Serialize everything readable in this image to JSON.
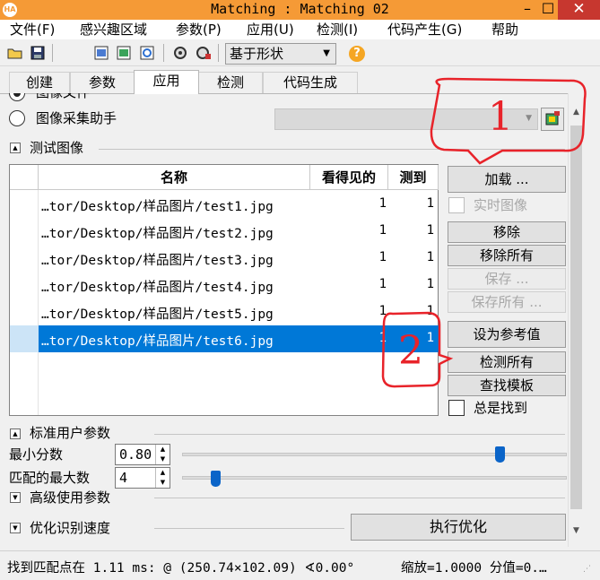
{
  "window": {
    "title": "Matching : Matching 02",
    "app_icon": "HA",
    "minimize": "–",
    "maximize": "☐",
    "close": "✕"
  },
  "menu": [
    "文件(F)",
    "感兴趣区域",
    "参数(P)",
    "应用(U)",
    "检测(I)",
    "代码产生(G)",
    "帮助"
  ],
  "toolbar": {
    "icons": [
      "open-folder-icon",
      "save-disk-icon",
      "image-icon",
      "image-add-icon",
      "image-refresh-icon",
      "gear-run-icon",
      "gear-settings-icon",
      "help-icon"
    ],
    "shape_select": "基于形状",
    "help": "?"
  },
  "tabs": [
    "创建",
    "参数",
    "应用",
    "检测",
    "代码生成"
  ],
  "active_tab": "应用",
  "source": {
    "image_file_label": "图像文件",
    "acq_assistant_label": "图像采集助手",
    "acq_combo_value": ""
  },
  "test_images": {
    "header": "测试图像",
    "columns": [
      "名称",
      "看得见的",
      "测到"
    ],
    "rows": [
      {
        "name": "…tor/Desktop/样品图片/test1.jpg",
        "visible": "1",
        "found": "1"
      },
      {
        "name": "…tor/Desktop/样品图片/test2.jpg",
        "visible": "1",
        "found": "1"
      },
      {
        "name": "…tor/Desktop/样品图片/test3.jpg",
        "visible": "1",
        "found": "1"
      },
      {
        "name": "…tor/Desktop/样品图片/test4.jpg",
        "visible": "1",
        "found": "1"
      },
      {
        "name": "…tor/Desktop/样品图片/test5.jpg",
        "visible": "1",
        "found": "1"
      },
      {
        "name": "…tor/Desktop/样品图片/test6.jpg",
        "visible": "1",
        "found": "1"
      }
    ],
    "selected_row": 5
  },
  "buttons": {
    "load": "加载 ...",
    "live_image": "实时图像",
    "remove": "移除",
    "remove_all": "移除所有",
    "save": "保存 ...",
    "save_all": "保存所有 ...",
    "set_reference": "设为参考值",
    "detect_all": "检测所有",
    "find_model": "查找模板",
    "always_find": "总是找到"
  },
  "std_params": {
    "header": "标准用户参数",
    "min_score_label": "最小分数",
    "min_score_value": "0.80",
    "min_score_slider": 0.8,
    "max_matches_label": "匹配的最大数",
    "max_matches_value": "4",
    "max_matches_slider": 0.04
  },
  "advanced": {
    "header": "高级使用参数"
  },
  "optimize": {
    "header": "优化识别速度",
    "button": "执行优化"
  },
  "status": {
    "left": "找到匹配点在 1.11 ms: @ (250.74×102.09) ∢0.00°",
    "right": "缩放=1.0000 分值=0.…"
  },
  "annotations": [
    "1",
    "2"
  ],
  "colors": {
    "titlebar": "#f59a36",
    "selection": "#0078d7",
    "annotation": "#e8232a",
    "slider": "#0a64c8"
  }
}
